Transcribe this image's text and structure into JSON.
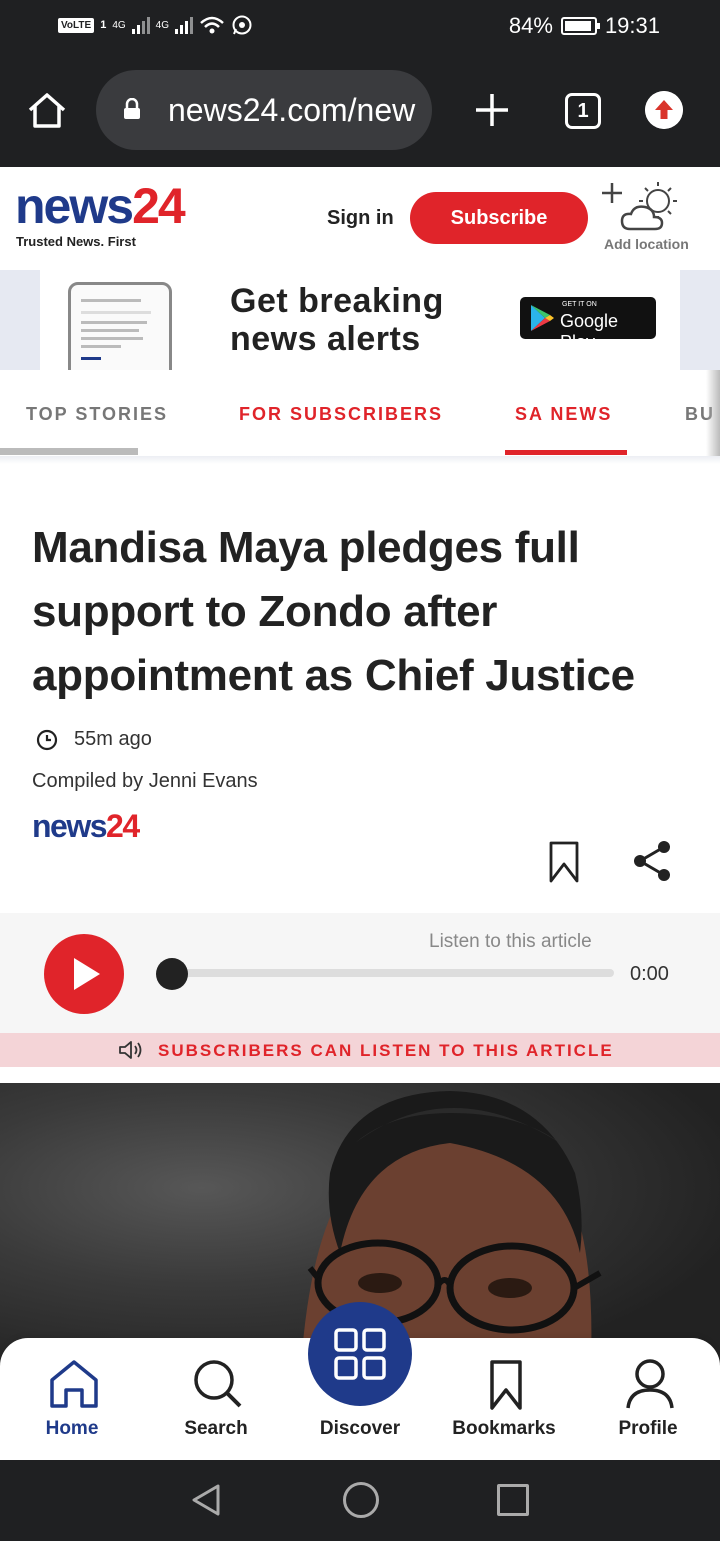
{
  "status_bar": {
    "network_badge": "VoLTE",
    "sim_slot": "1",
    "net_type_1": "4G",
    "net_type_2": "4G",
    "battery": "84%",
    "time": "19:31"
  },
  "browser": {
    "url": "news24.com/new",
    "tab_count": "1"
  },
  "header": {
    "logo_news": "news",
    "logo_24": "24",
    "tagline": "Trusted News. First",
    "signin_label": "Sign in",
    "subscribe_label": "Subscribe",
    "add_location_label": "Add location"
  },
  "promo": {
    "line1": "Get breaking",
    "line2": "news alerts",
    "store_top": "GET IT ON",
    "store_main": "Google Play"
  },
  "tabs": [
    {
      "label": "TOP STORIES"
    },
    {
      "label": "FOR SUBSCRIBERS"
    },
    {
      "label": "SA NEWS",
      "active": true
    },
    {
      "label": "BU"
    }
  ],
  "article": {
    "headline": "Mandisa Maya pledges full support to Zondo after appointment as Chief Justice",
    "time_ago": "55m ago",
    "byline": "Compiled by Jenni Evans",
    "source_logo_news": "news",
    "source_logo_24": "24"
  },
  "player": {
    "listen_label": "Listen to this article",
    "time": "0:00",
    "progress": 0,
    "subscribers_notice": "SUBSCRIBERS CAN LISTEN TO THIS ARTICLE"
  },
  "bottom_nav": [
    {
      "label": "Home",
      "icon": "home-icon",
      "active": true
    },
    {
      "label": "Search",
      "icon": "search-icon"
    },
    {
      "label": "Discover",
      "icon": "grid-icon"
    },
    {
      "label": "Bookmarks",
      "icon": "bookmark-icon"
    },
    {
      "label": "Profile",
      "icon": "profile-icon"
    }
  ],
  "colors": {
    "brand_blue": "#1f3a8a",
    "brand_red": "#e0242a",
    "dark_bar": "#1f2022"
  }
}
